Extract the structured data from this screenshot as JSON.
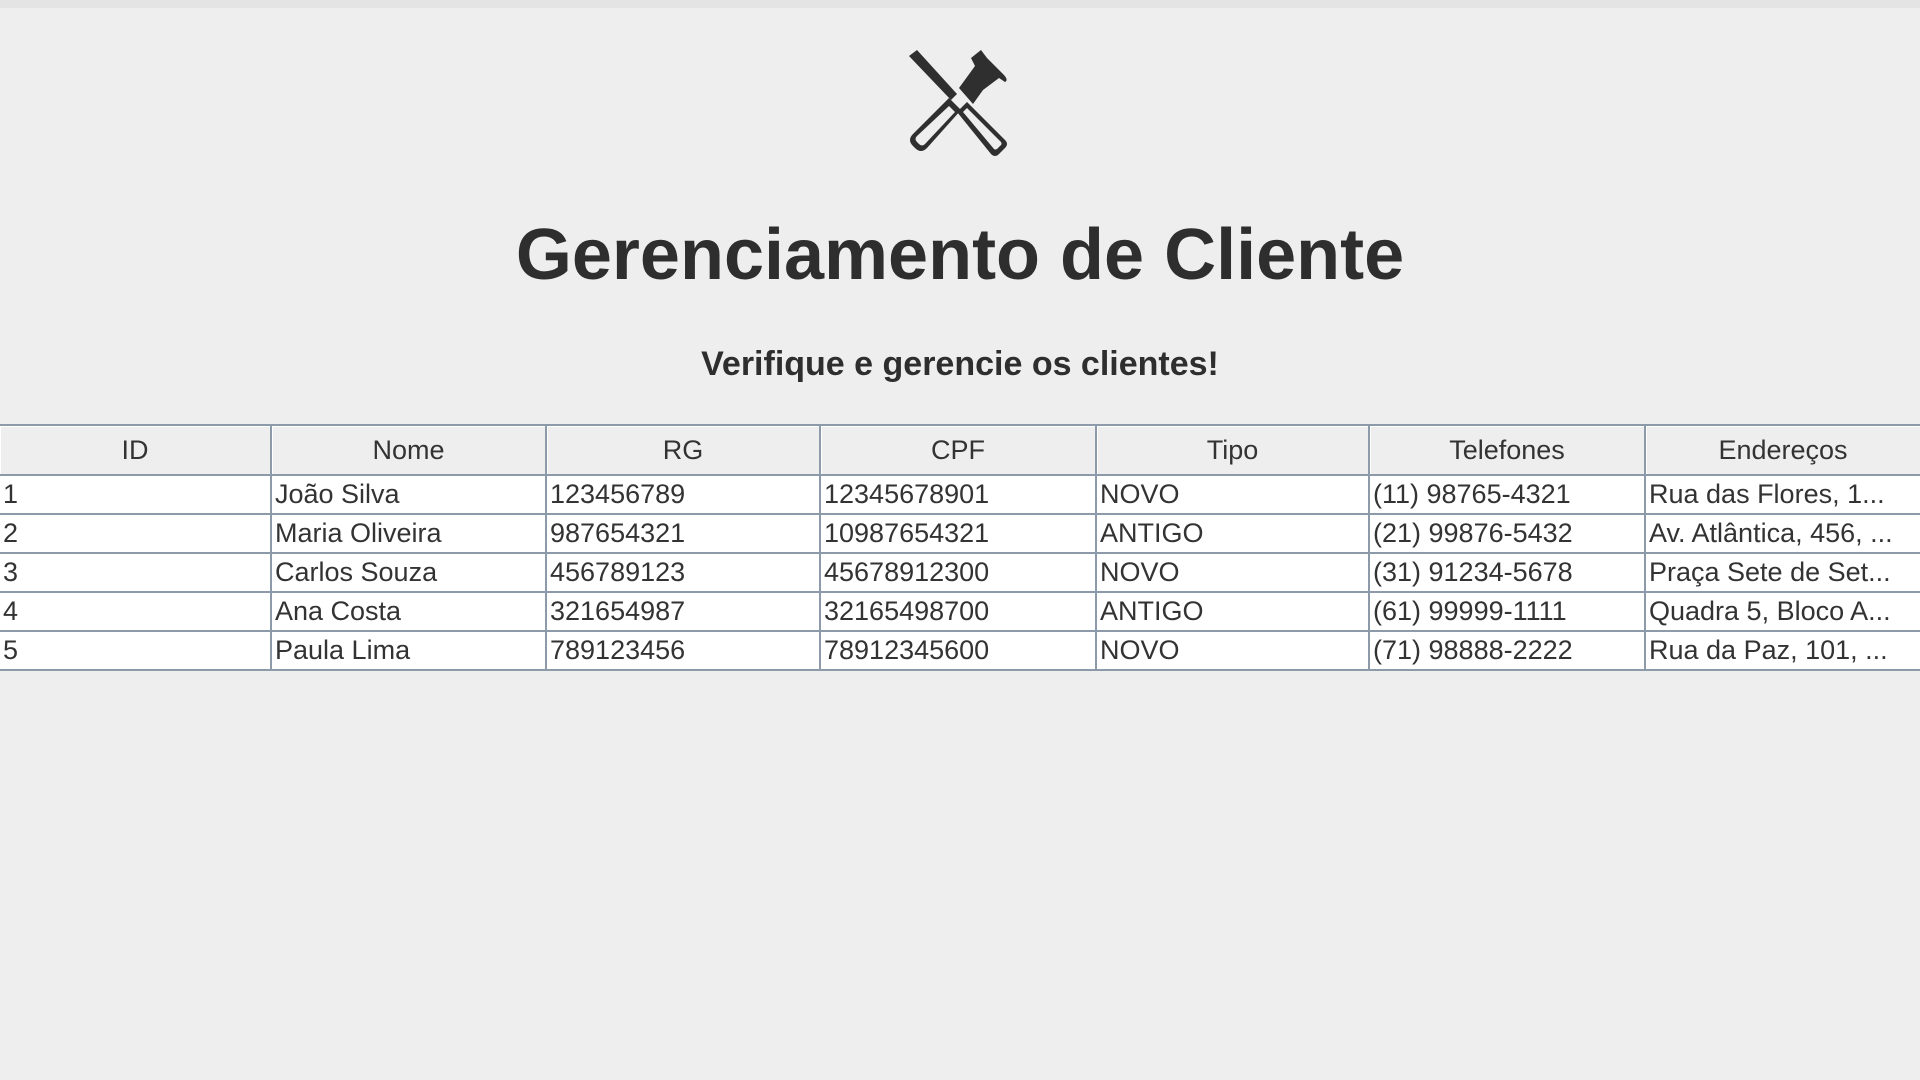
{
  "header": {
    "logo_icon": "tools-icon",
    "title": "Gerenciamento de Cliente",
    "subtitle": "Verifique e gerencie os clientes!"
  },
  "table": {
    "columns": [
      "ID",
      "Nome",
      "RG",
      "CPF",
      "Tipo",
      "Telefones",
      "Endereços"
    ],
    "rows": [
      {
        "id": "1",
        "nome": "João Silva",
        "rg": "123456789",
        "cpf": "12345678901",
        "tipo": "NOVO",
        "telefones": "(11) 98765-4321",
        "enderecos": "Rua das Flores, 1..."
      },
      {
        "id": "2",
        "nome": "Maria Oliveira",
        "rg": "987654321",
        "cpf": "10987654321",
        "tipo": "ANTIGO",
        "telefones": "(21) 99876-5432",
        "enderecos": "Av. Atlântica, 456, ..."
      },
      {
        "id": "3",
        "nome": "Carlos Souza",
        "rg": "456789123",
        "cpf": "45678912300",
        "tipo": "NOVO",
        "telefones": "(31) 91234-5678",
        "enderecos": "Praça Sete de Set..."
      },
      {
        "id": "4",
        "nome": "Ana Costa",
        "rg": "321654987",
        "cpf": "32165498700",
        "tipo": "ANTIGO",
        "telefones": "(61) 99999-1111",
        "enderecos": "Quadra 5, Bloco A..."
      },
      {
        "id": "5",
        "nome": "Paula Lima",
        "rg": "789123456",
        "cpf": "78912345600",
        "tipo": "NOVO",
        "telefones": "(71) 98888-2222",
        "enderecos": "Rua da Paz, 101, ..."
      }
    ]
  }
}
